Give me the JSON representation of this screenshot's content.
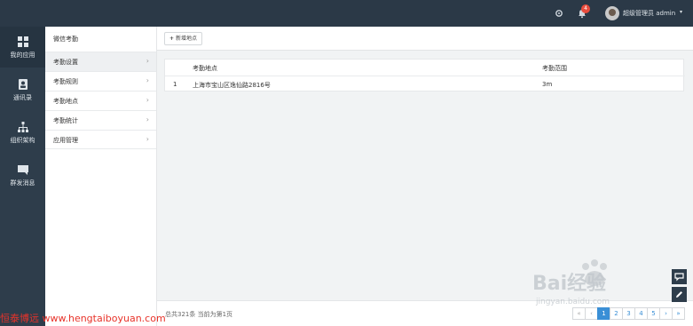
{
  "topbar": {
    "notification_count": "4",
    "user_label": "超级管理员 admin",
    "icons": [
      "settings-icon",
      "bell-icon",
      "chevron-down-icon"
    ]
  },
  "leftnav": {
    "items": [
      {
        "label": "我的应用",
        "icon": "grid-icon"
      },
      {
        "label": "通讯录",
        "icon": "contacts-icon"
      },
      {
        "label": "组织架构",
        "icon": "org-chart-icon"
      },
      {
        "label": "群发消息",
        "icon": "message-icon"
      }
    ]
  },
  "subnav": {
    "title": "微信考勤",
    "items": [
      {
        "label": "考勤设置"
      },
      {
        "label": "考勤规则"
      },
      {
        "label": "考勤地点"
      },
      {
        "label": "考勤统计"
      },
      {
        "label": "应用管理"
      }
    ]
  },
  "toolbar": {
    "add_label": "新增地点"
  },
  "table": {
    "columns": [
      "考勤地点",
      "考勤范围"
    ],
    "rows": [
      {
        "index": "1",
        "location": "上海市宝山区逸仙路2816号",
        "range": "3m"
      }
    ]
  },
  "footer": {
    "total_text": "总共321条 当前为第1页",
    "pages": [
      "1",
      "2",
      "3",
      "4",
      "5"
    ],
    "current_page": "1",
    "first": "«",
    "prev": "‹",
    "next": "›",
    "last": "»"
  },
  "watermark": {
    "text": "恒泰博远 www.hengtaiboyuan.com",
    "logo_text": "Bai经验",
    "logo_url": "jingyan.baidu.com"
  },
  "colors": {
    "topbar": "#2b3947",
    "sidebar": "#2e3d4b",
    "accent": "#3a8fd6",
    "badge": "#e84c3d"
  }
}
